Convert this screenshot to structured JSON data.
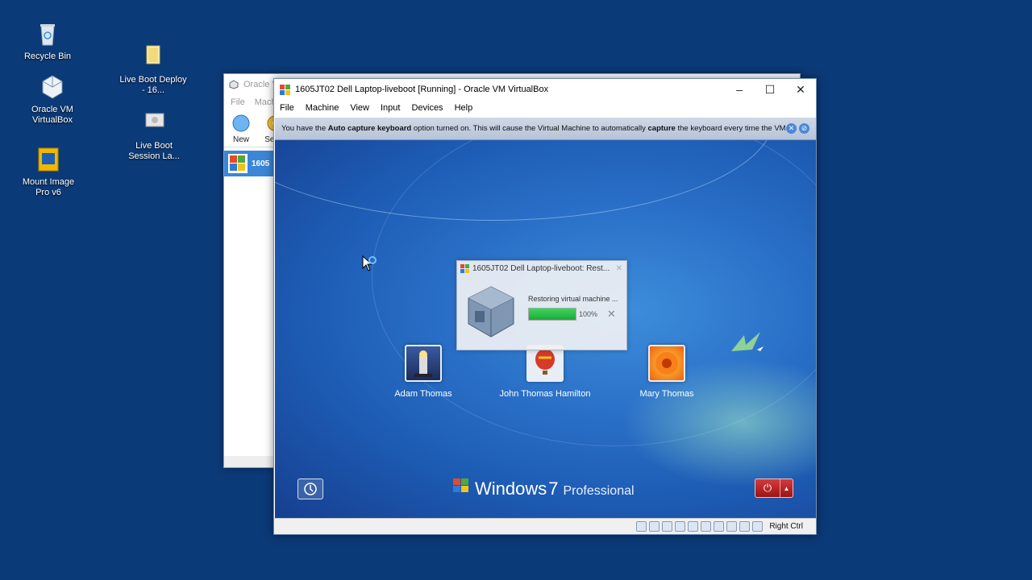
{
  "desktop": {
    "icons": [
      {
        "label": "Recycle Bin",
        "icon": "recycle-bin-icon"
      },
      {
        "label": "Oracle VM VirtualBox",
        "icon": "virtualbox-icon"
      },
      {
        "label": "Mount Image Pro v6",
        "icon": "mount-image-icon"
      },
      {
        "label": "Live Boot Deploy - 16...",
        "icon": "folder-icon"
      },
      {
        "label": "Live Boot Session La...",
        "icon": "shortcut-icon"
      }
    ]
  },
  "manager": {
    "title": "Oracle V",
    "menu": [
      "File",
      "Machi"
    ],
    "tools": [
      "New",
      "Settin"
    ],
    "vm_item": "1605"
  },
  "vm_window": {
    "title": "1605JT02 Dell Laptop-liveboot [Running] - Oracle VM VirtualBox",
    "controls": {
      "minimize": "–",
      "maximize": "☐",
      "close": "✕"
    },
    "menu": [
      "File",
      "Machine",
      "View",
      "Input",
      "Devices",
      "Help"
    ],
    "notice": {
      "part1": "You have the ",
      "bold1": "Auto capture keyboard",
      "part2": " option turned on. This will cause the Virtual Machine to automatically ",
      "bold2": "capture",
      "part3": " the keyboard every time the VM"
    },
    "status_right": "Right Ctrl"
  },
  "guest": {
    "users": [
      {
        "name": "Adam Thomas"
      },
      {
        "name": "John Thomas Hamilton"
      },
      {
        "name": "Mary Thomas"
      }
    ],
    "brand_windows": "Windows",
    "brand_version": "7",
    "brand_edition": "Professional"
  },
  "restore_dialog": {
    "title": "1605JT02 Dell Laptop-liveboot: Rest...",
    "message": "Restoring virtual machine ...",
    "progress_label": "100%",
    "progress": 1.0
  },
  "colors": {
    "desktop_bg": "#0b3a78",
    "progress_fill": "#1ea83c",
    "power_button": "#b52020"
  }
}
